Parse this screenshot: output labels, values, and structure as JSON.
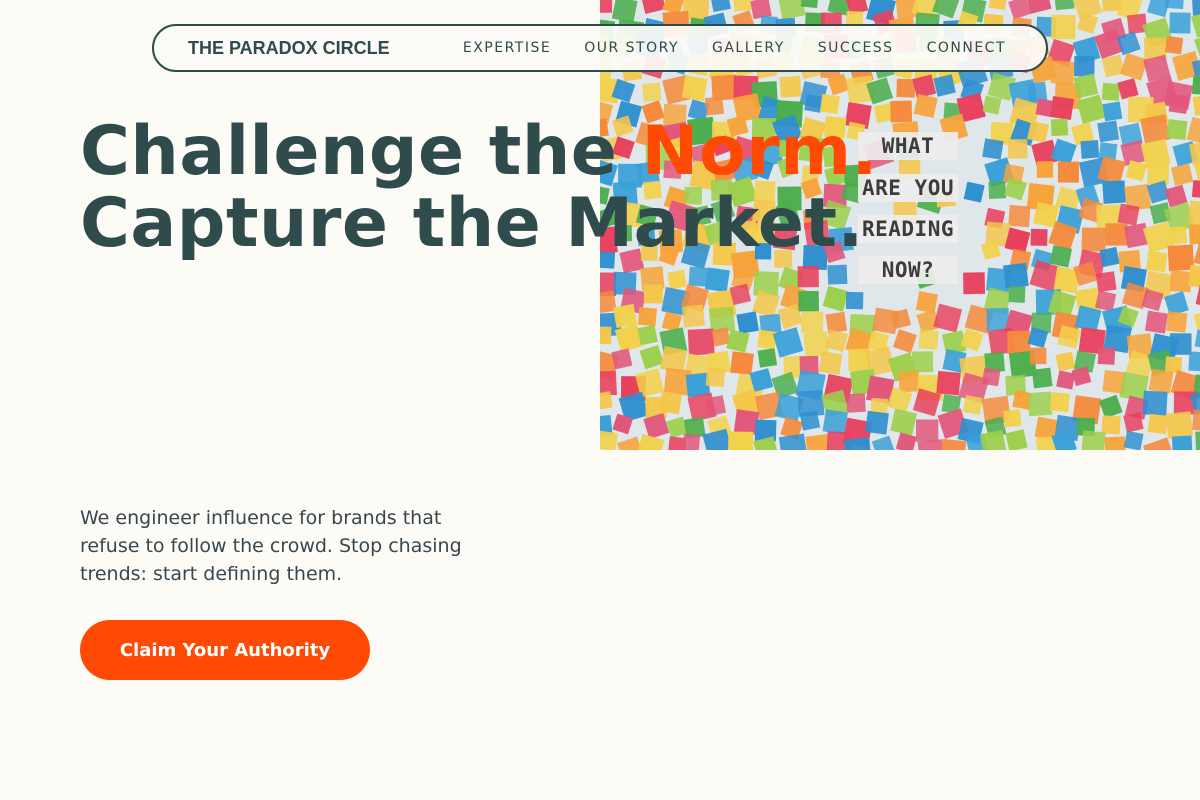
{
  "brand": {
    "name": "THE PARADOX CIRCLE"
  },
  "nav": {
    "links": [
      "EXPERTISE",
      "OUR STORY",
      "GALLERY",
      "SUCCESS",
      "CONNECT"
    ]
  },
  "hero": {
    "headline_part1": "Challenge the ",
    "headline_accent": "Norm.",
    "headline_part2": "Capture the Market.",
    "subtext": "We engineer influence for brands that refuse to follow the crowd. Stop chasing trends: start defining them.",
    "cta_label": "Claim Your Authority"
  },
  "image": {
    "sign_lines": [
      "WHAT",
      "ARE YOU",
      "READING",
      "NOW?"
    ]
  },
  "colors": {
    "accent": "#ff4a04",
    "text_dark": "#2f4b4c",
    "background": "#fcfbf6"
  }
}
